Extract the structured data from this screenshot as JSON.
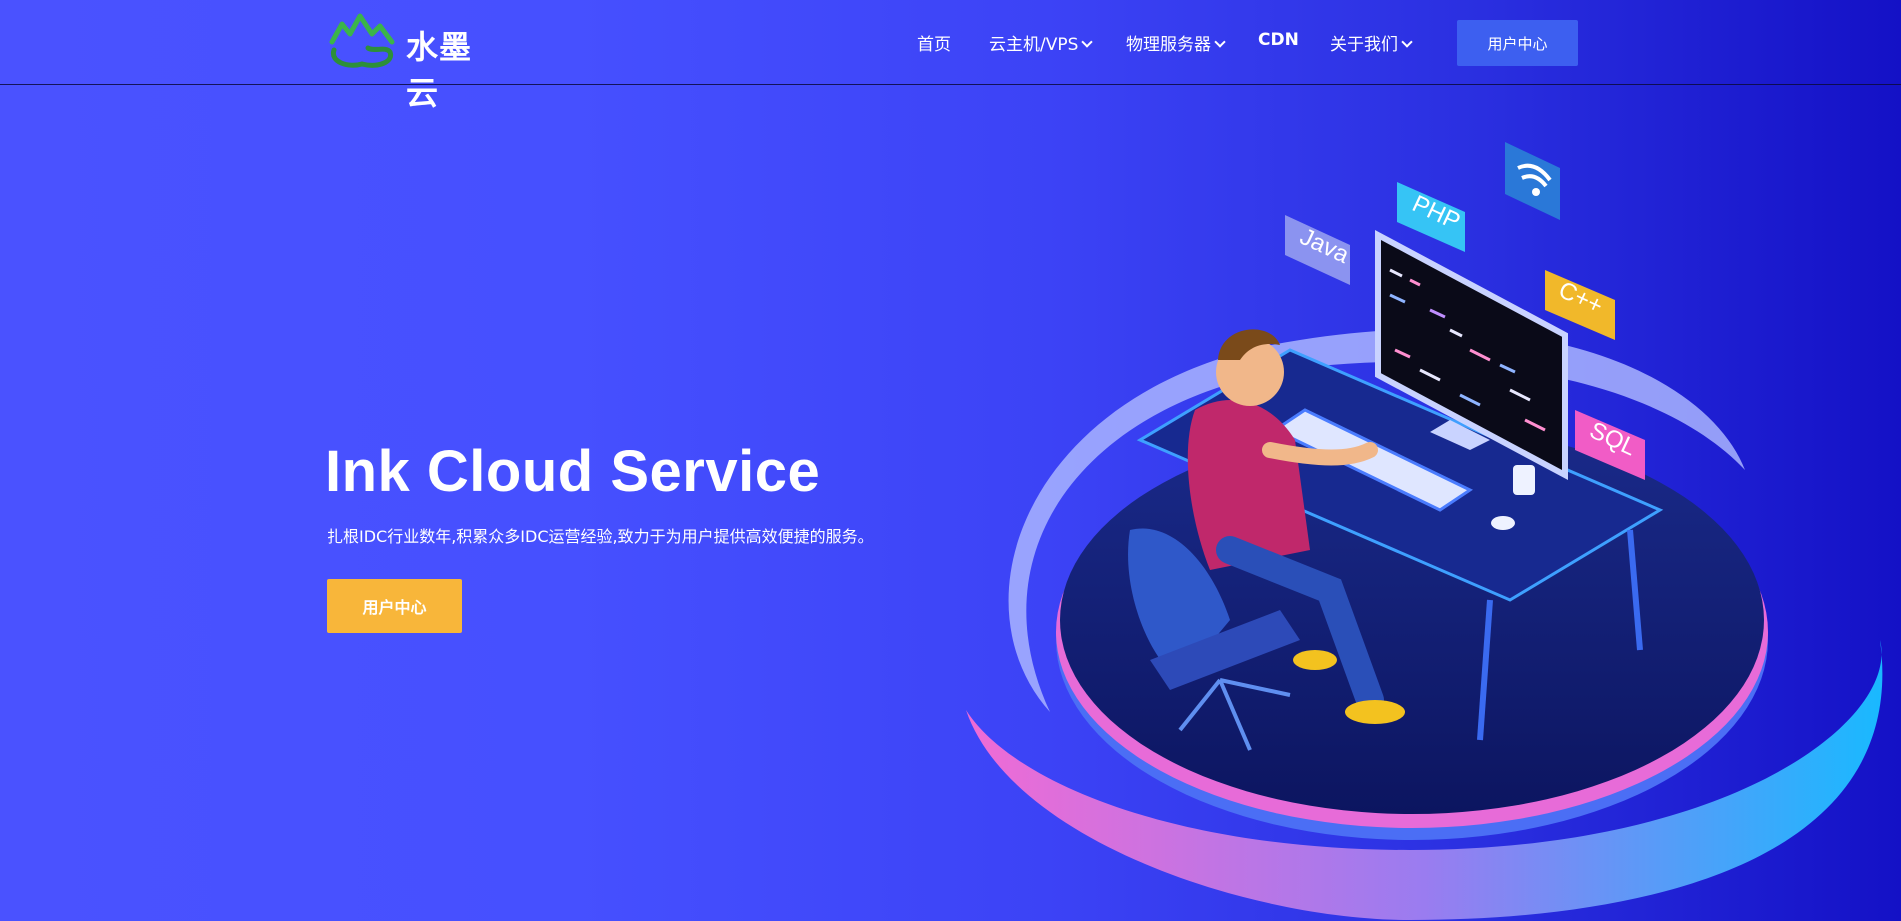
{
  "brand": {
    "name": "水墨云",
    "logo_icon": "mountain-cloud-icon"
  },
  "nav": {
    "items": [
      {
        "label": "首页",
        "has_dropdown": false
      },
      {
        "label": "云主机/VPS",
        "has_dropdown": true
      },
      {
        "label": "物理服务器",
        "has_dropdown": true
      },
      {
        "label": "CDN",
        "has_dropdown": false
      },
      {
        "label": "关于我们",
        "has_dropdown": true
      }
    ],
    "cta_label": "用户中心"
  },
  "hero": {
    "title": "Ink Cloud Service",
    "subtitle": "扎根IDC行业数年,积累众多IDC运营经验,致力于为用户提供高效便捷的服务。",
    "button_label": "用户中心"
  },
  "illustration": {
    "badges": [
      "Java",
      "PHP",
      "C++",
      "SQL"
    ]
  },
  "colors": {
    "accent_button": "#f8b63a",
    "nav_button": "#3d5ff0",
    "logo_green": "#3bb44a"
  }
}
